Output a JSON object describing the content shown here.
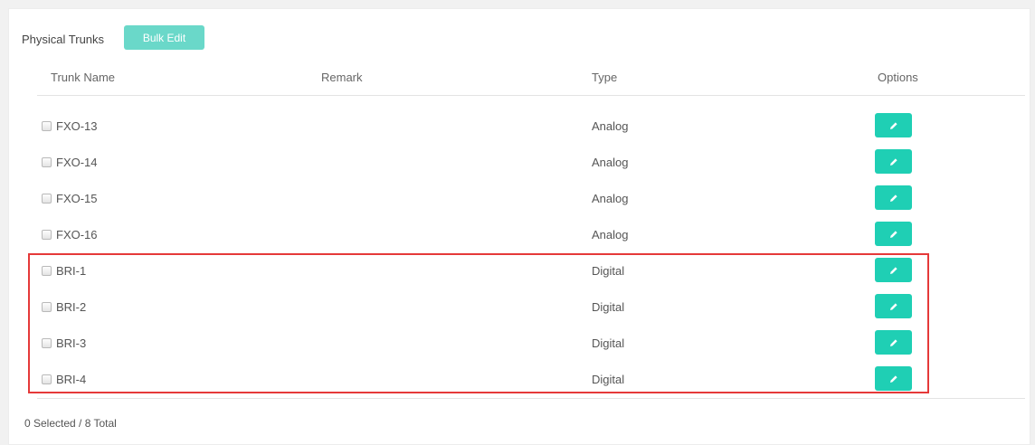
{
  "panel": {
    "title": "Physical Trunks",
    "bulk_edit_label": "Bulk Edit"
  },
  "columns": {
    "name": "Trunk Name",
    "remark": "Remark",
    "type": "Type",
    "options": "Options"
  },
  "rows": [
    {
      "name": "FXO-13",
      "remark": "",
      "type": "Analog"
    },
    {
      "name": "FXO-14",
      "remark": "",
      "type": "Analog"
    },
    {
      "name": "FXO-15",
      "remark": "",
      "type": "Analog"
    },
    {
      "name": "FXO-16",
      "remark": "",
      "type": "Analog"
    },
    {
      "name": "BRI-1",
      "remark": "",
      "type": "Digital"
    },
    {
      "name": "BRI-2",
      "remark": "",
      "type": "Digital"
    },
    {
      "name": "BRI-3",
      "remark": "",
      "type": "Digital"
    },
    {
      "name": "BRI-4",
      "remark": "",
      "type": "Digital"
    }
  ],
  "footer": {
    "selection_status": "0 Selected / 8 Total"
  },
  "icons": {
    "edit": "pencil-icon"
  },
  "colors": {
    "accent": "#1fcfb4",
    "bulk_button": "#6ad8c9",
    "highlight_border": "#e53939"
  }
}
